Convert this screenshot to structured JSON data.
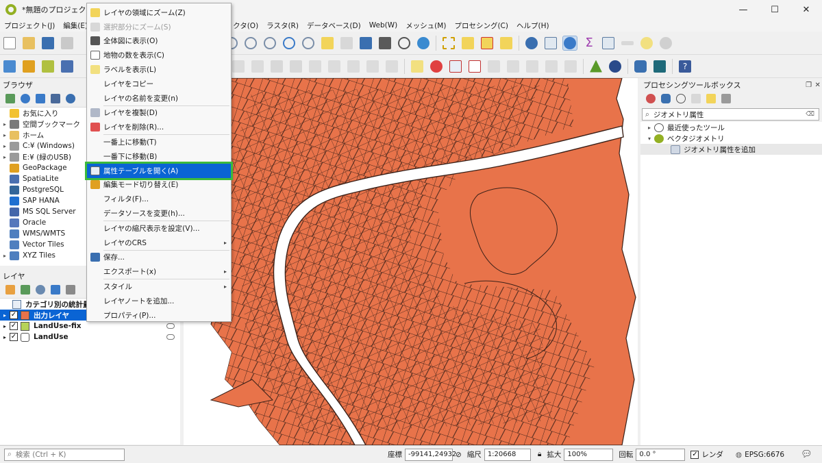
{
  "window": {
    "title": "*無題のプロジェクト —",
    "minimize": "—",
    "maximize": "☐",
    "close": "✕"
  },
  "menubar": [
    "プロジェクト(J)",
    "編集(E)",
    "",
    "",
    "クタ(O)",
    "ラスタ(R)",
    "データベース(D)",
    "Web(W)",
    "メッシュ(M)",
    "プロセシング(C)",
    "ヘルプ(H)"
  ],
  "browser": {
    "title": "ブラウザ",
    "items": [
      {
        "label": "お気に入り",
        "arrow": "",
        "icon": "star-icon",
        "color": "#f2c230"
      },
      {
        "label": "空間ブックマーク",
        "arrow": "▸",
        "icon": "bookmark-icon",
        "color": "#7a7a7a"
      },
      {
        "label": "ホーム",
        "arrow": "▸",
        "icon": "folder-icon",
        "color": "#e8c060"
      },
      {
        "label": "C:¥ (Windows)",
        "arrow": "▸",
        "icon": "drive-icon",
        "color": "#9a9a9a"
      },
      {
        "label": "E:¥ (緑のUSB)",
        "arrow": "▸",
        "icon": "drive-icon",
        "color": "#9a9a9a"
      },
      {
        "label": "GeoPackage",
        "arrow": "",
        "icon": "geopackage-icon",
        "color": "#e0a020"
      },
      {
        "label": "SpatiaLite",
        "arrow": "",
        "icon": "spatialite-icon",
        "color": "#4a70b0"
      },
      {
        "label": "PostgreSQL",
        "arrow": "",
        "icon": "postgresql-icon",
        "color": "#336699"
      },
      {
        "label": "SAP HANA",
        "arrow": "",
        "icon": "sap-hana-icon",
        "color": "#1f6fd0"
      },
      {
        "label": "MS SQL Server",
        "arrow": "",
        "icon": "mssql-icon",
        "color": "#4466aa"
      },
      {
        "label": "Oracle",
        "arrow": "",
        "icon": "oracle-icon",
        "color": "#5577bb"
      },
      {
        "label": "WMS/WMTS",
        "arrow": "",
        "icon": "globe-icon",
        "color": "#4f7fbf"
      },
      {
        "label": "Vector Tiles",
        "arrow": "",
        "icon": "vector-tiles-icon",
        "color": "#4f7fbf"
      },
      {
        "label": "XYZ Tiles",
        "arrow": "▸",
        "icon": "xyz-tiles-icon",
        "color": "#4f7fbf"
      }
    ]
  },
  "layers": {
    "title": "レイヤ",
    "items": [
      {
        "label": "カテゴリ別の統計量",
        "checked": false,
        "swatch": "",
        "selected": false,
        "table": true
      },
      {
        "label": "出力レイヤ",
        "checked": true,
        "swatch": "#e8734a",
        "selected": true,
        "table": false
      },
      {
        "label": "LandUse-fix",
        "checked": true,
        "swatch": "#b6d35a",
        "selected": false,
        "table": false
      },
      {
        "label": "LandUse",
        "checked": true,
        "swatch": "",
        "selected": false,
        "table": false
      }
    ]
  },
  "context_menu": {
    "items": [
      {
        "label": "レイヤの領域にズーム(Z)",
        "icon": "zoom-layer-icon",
        "type": "item"
      },
      {
        "label": "選択部分にズーム(S)",
        "icon": "zoom-selection-icon",
        "type": "disabled"
      },
      {
        "label": "全体図に表示(O)",
        "icon": "overview-icon",
        "type": "item"
      },
      {
        "label": "地物の数を表示(C)",
        "icon": "checkbox-icon",
        "type": "item"
      },
      {
        "label": "ラベルを表示(L)",
        "icon": "label-icon",
        "type": "item"
      },
      {
        "label": "レイヤをコピー",
        "icon": "",
        "type": "item"
      },
      {
        "label": "レイヤの名前を変更(n)",
        "icon": "",
        "type": "item"
      },
      {
        "type": "sep"
      },
      {
        "label": "レイヤを複製(D)",
        "icon": "duplicate-icon",
        "type": "item"
      },
      {
        "label": "レイヤを削除(R)...",
        "icon": "remove-layer-icon",
        "type": "item"
      },
      {
        "type": "sep"
      },
      {
        "label": "一番上に移動(T)",
        "icon": "",
        "type": "item"
      },
      {
        "label": "一番下に移動(B)",
        "icon": "",
        "type": "item"
      },
      {
        "label": "属性テーブルを開く(A)",
        "icon": "table-icon",
        "type": "highlight"
      },
      {
        "label": "編集モード切り替え(E)",
        "icon": "pencil-icon",
        "type": "item"
      },
      {
        "label": "フィルタ(F)...",
        "icon": "",
        "type": "item"
      },
      {
        "label": "データソースを変更(h)...",
        "icon": "",
        "type": "item"
      },
      {
        "type": "sep"
      },
      {
        "label": "レイヤの縮尺表示を設定(V)...",
        "icon": "",
        "type": "item"
      },
      {
        "label": "レイヤのCRS",
        "icon": "",
        "type": "submenu"
      },
      {
        "type": "sep"
      },
      {
        "label": "保存...",
        "icon": "save-icon",
        "type": "item"
      },
      {
        "label": "エクスポート(x)",
        "icon": "",
        "type": "submenu"
      },
      {
        "type": "sep"
      },
      {
        "label": "スタイル",
        "icon": "",
        "type": "submenu"
      },
      {
        "label": "レイヤノートを追加...",
        "icon": "",
        "type": "item"
      },
      {
        "label": "プロパティ(P)...",
        "icon": "",
        "type": "item"
      }
    ]
  },
  "processing": {
    "title": "プロセシングツールボックス",
    "search_value": "ジオメトリ属性",
    "tree": [
      {
        "label": "最近使ったツール",
        "arrow": "▸",
        "indent": 0,
        "icon": "clock-icon"
      },
      {
        "label": "ベクタジオメトリ",
        "arrow": "▾",
        "indent": 0,
        "icon": "qgis-icon"
      },
      {
        "label": "ジオメトリ属性を追加",
        "arrow": "",
        "indent": 1,
        "icon": "algorithm-icon"
      }
    ]
  },
  "statusbar": {
    "search_placeholder": "検索 (Ctrl + K)",
    "coord_label": "座標",
    "coord_value": "-99141,24932",
    "scale_label": "縮尺",
    "scale_value": "1:20668",
    "magnifier_label": "拡大",
    "magnifier_value": "100%",
    "rotation_label": "回転",
    "rotation_value": "0.0 °",
    "render_label": "レンダ",
    "crs": "EPSG:6676"
  },
  "colors": {
    "map_fill": "#e8734a",
    "map_line": "#3a2018",
    "highlight": "#0a64d4",
    "menu_outline": "#3cba3c"
  }
}
